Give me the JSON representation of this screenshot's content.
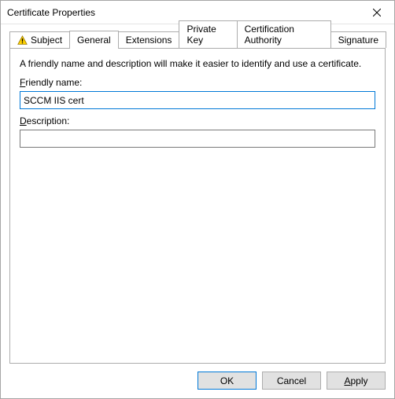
{
  "window": {
    "title": "Certificate Properties"
  },
  "tabs": [
    {
      "label": "Subject",
      "warn": true
    },
    {
      "label": "General"
    },
    {
      "label": "Extensions"
    },
    {
      "label": "Private Key"
    },
    {
      "label": "Certification Authority"
    },
    {
      "label": "Signature"
    }
  ],
  "panel": {
    "intro": "A friendly name and description will make it easier to identify and use a certificate.",
    "friendly_label_pre": "F",
    "friendly_label_rest": "riendly name:",
    "friendly_value": "SCCM IIS cert",
    "description_label_pre": "D",
    "description_label_rest": "escription:",
    "description_value": ""
  },
  "buttons": {
    "ok": "OK",
    "cancel": "Cancel",
    "apply_pre": "A",
    "apply_rest": "pply"
  }
}
